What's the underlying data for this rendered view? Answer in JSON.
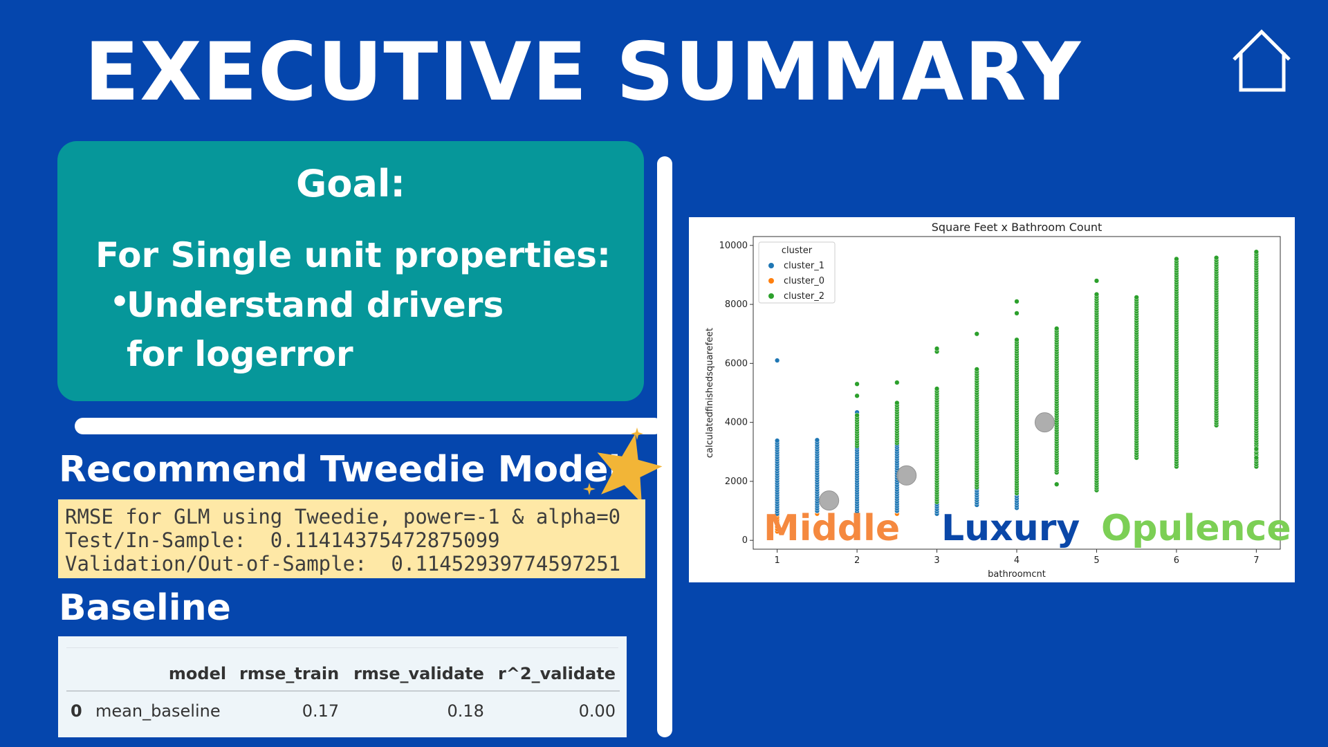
{
  "slide": {
    "title": "EXECUTIVE SUMMARY",
    "background_color": "#0546AD",
    "home_icon": "house-outline-icon"
  },
  "goal": {
    "heading": "Goal:",
    "subheading": "For Single unit properties:",
    "bullet": "Understand drivers for logerror",
    "box_color": "#06979A"
  },
  "recommendation": {
    "heading": "Recommend Tweedie Model",
    "star_icon": "star-icon",
    "lines": [
      "RMSE for GLM using Tweedie, power=-1 & alpha=0",
      "Test/In-Sample:  0.11414375472875099",
      "Validation/Out-of-Sample:  0.11452939774597251"
    ]
  },
  "baseline": {
    "heading": "Baseline",
    "columns": [
      "",
      "model",
      "rmse_train",
      "rmse_validate",
      "r^2_validate"
    ],
    "rows": [
      [
        "0",
        "mean_baseline",
        "0.17",
        "0.18",
        "0.00"
      ]
    ]
  },
  "chart_data": {
    "type": "scatter",
    "title": "Square Feet x Bathroom Count",
    "xlabel": "bathroomcnt",
    "ylabel": "calculatedfinishedsquarefeet",
    "xlim": [
      0.7,
      7.3
    ],
    "ylim": [
      -300,
      10300
    ],
    "xticks": [
      1,
      2,
      3,
      4,
      5,
      6,
      7
    ],
    "yticks": [
      0,
      2000,
      4000,
      6000,
      8000,
      10000
    ],
    "legend": {
      "title": "cluster",
      "position": "top-left"
    },
    "series": [
      {
        "name": "cluster_1",
        "color": "#1f77b4",
        "columns": [
          {
            "x": 1.0,
            "y_min": 900,
            "y_max": 3450,
            "outliers": [
              6100
            ]
          },
          {
            "x": 1.5,
            "y_min": 1000,
            "y_max": 3450,
            "outliers": []
          },
          {
            "x": 2.0,
            "y_min": 900,
            "y_max": 4400,
            "outliers": []
          },
          {
            "x": 2.5,
            "y_min": 1000,
            "y_max": 4100,
            "outliers": []
          },
          {
            "x": 3.0,
            "y_min": 900,
            "y_max": 4100,
            "outliers": []
          },
          {
            "x": 3.5,
            "y_min": 1200,
            "y_max": 4200,
            "outliers": []
          },
          {
            "x": 4.0,
            "y_min": 1100,
            "y_max": 3300,
            "outliers": []
          }
        ]
      },
      {
        "name": "cluster_0",
        "color": "#ff7f0e",
        "columns": [
          {
            "x": 1.0,
            "y_min": 300,
            "y_max": 3300,
            "outliers": []
          },
          {
            "x": 1.5,
            "y_min": 900,
            "y_max": 2500,
            "outliers": []
          },
          {
            "x": 2.0,
            "y_min": 600,
            "y_max": 2300,
            "outliers": []
          },
          {
            "x": 2.5,
            "y_min": 900,
            "y_max": 2300,
            "outliers": []
          },
          {
            "x": 3.0,
            "y_min": 1000,
            "y_max": 2200,
            "outliers": []
          }
        ]
      },
      {
        "name": "cluster_2",
        "color": "#2ca02c",
        "columns": [
          {
            "x": 2.0,
            "y_min": 3200,
            "y_max": 4300,
            "outliers": [
              4900,
              5300
            ]
          },
          {
            "x": 2.5,
            "y_min": 3300,
            "y_max": 4700,
            "outliers": [
              5350
            ]
          },
          {
            "x": 3.0,
            "y_min": 1300,
            "y_max": 5200,
            "outliers": [
              6400,
              6500
            ]
          },
          {
            "x": 3.5,
            "y_min": 1800,
            "y_max": 5800,
            "outliers": [
              7000
            ]
          },
          {
            "x": 4.0,
            "y_min": 1600,
            "y_max": 6800,
            "outliers": [
              7700,
              8100
            ]
          },
          {
            "x": 4.5,
            "y_min": 2300,
            "y_max": 7200,
            "outliers": [
              1900
            ]
          },
          {
            "x": 5.0,
            "y_min": 1700,
            "y_max": 8400,
            "outliers": [
              8800
            ]
          },
          {
            "x": 5.5,
            "y_min": 2800,
            "y_max": 8300,
            "outliers": []
          },
          {
            "x": 6.0,
            "y_min": 2500,
            "y_max": 9600,
            "outliers": []
          },
          {
            "x": 6.5,
            "y_min": 3900,
            "y_max": 9600,
            "outliers": []
          },
          {
            "x": 7.0,
            "y_min": 2500,
            "y_max": 9800,
            "outliers": [
              2800,
              3100
            ]
          }
        ]
      }
    ],
    "centroids": [
      {
        "x": 1.65,
        "y": 1350,
        "color": "#a6a6a6"
      },
      {
        "x": 2.62,
        "y": 2200,
        "color": "#a6a6a6"
      },
      {
        "x": 4.35,
        "y": 4000,
        "color": "#a6a6a6"
      }
    ]
  },
  "cluster_labels": [
    {
      "text": "Middle",
      "color": "#F5893F"
    },
    {
      "text": "Luxury",
      "color": "#0A47A8"
    },
    {
      "text": "Opulence",
      "color": "#7CCF55"
    }
  ]
}
